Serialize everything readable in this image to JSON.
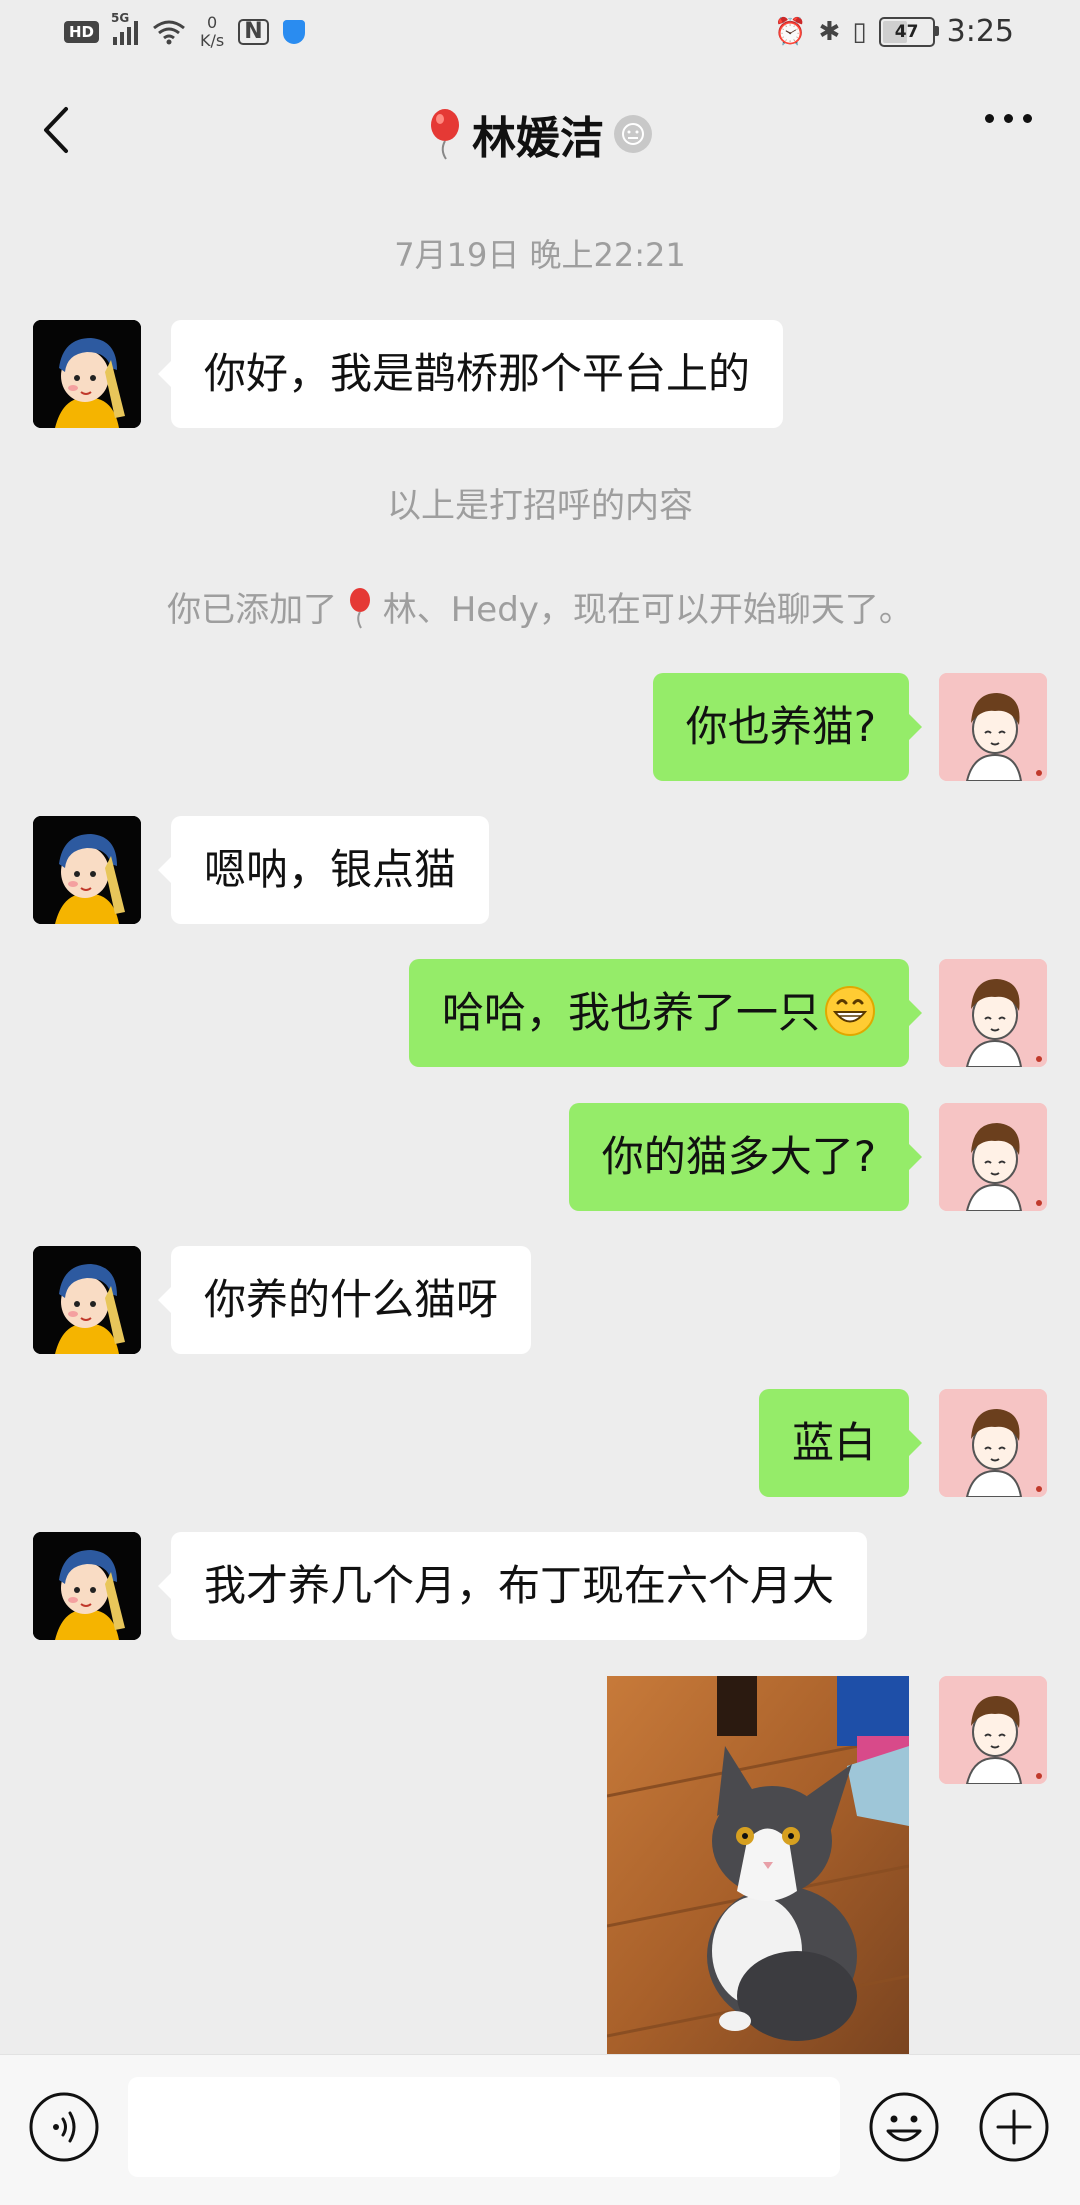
{
  "status_bar": {
    "left_hd": "HD",
    "left_network": "5G",
    "left_speed_value": "0",
    "left_speed_unit": "K/s",
    "nfc": "N",
    "battery": "47",
    "time": "3:25"
  },
  "header": {
    "back_icon": "chevron-left-icon",
    "title": "林媛洁",
    "more_icon": "more-dots-icon"
  },
  "chat": {
    "timestamp": "7月19日 晚上22:21",
    "system_greeting": "以上是打招呼的内容",
    "system_added_prefix": "你已添加了",
    "system_added_suffix": "林、Hedy，现在可以开始聊天了。",
    "messages": [
      {
        "side": "left",
        "text": "你好，我是鹊桥那个平台上的"
      },
      {
        "side": "right",
        "text": "你也养猫?"
      },
      {
        "side": "left",
        "text": "嗯呐，银点猫"
      },
      {
        "side": "right",
        "text": "哈哈，我也养了一只"
      },
      {
        "side": "right",
        "text": "你的猫多大了?"
      },
      {
        "side": "left",
        "text": "你养的什么猫呀"
      },
      {
        "side": "right",
        "text": "蓝白"
      },
      {
        "side": "left",
        "text": "我才养几个月，布丁现在六个月大"
      },
      {
        "side": "right",
        "type": "image",
        "icon": "cat-photo"
      }
    ]
  },
  "input_bar": {
    "voice_icon": "voice-icon",
    "emoji_icon": "emoji-icon",
    "plus_icon": "plus-icon",
    "value": ""
  },
  "colors": {
    "background": "#ededed",
    "bubble_self": "#95ec69",
    "bubble_other": "#ffffff",
    "system_text": "#9e9e9e"
  }
}
